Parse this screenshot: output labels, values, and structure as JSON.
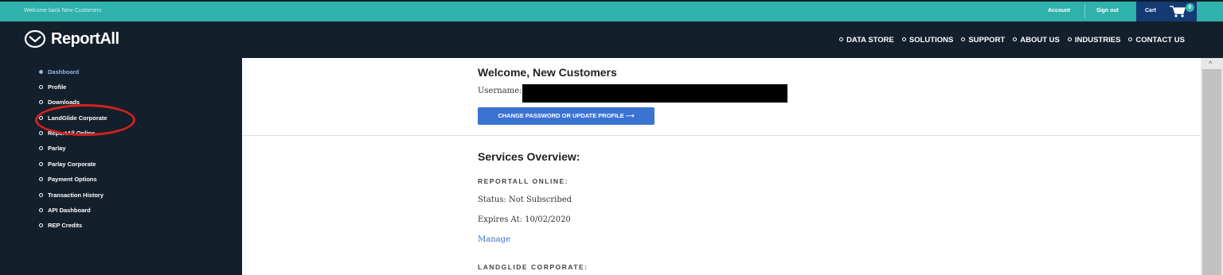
{
  "topbar": {
    "welcome_text": "Welcome back New Customers",
    "account_label": "Account",
    "signout_label": "Sign out",
    "cart_label": "Cart",
    "cart_count": "0"
  },
  "header": {
    "logo_text": "ReportAll",
    "nav": [
      "DATA STORE",
      "SOLUTIONS",
      "SUPPORT",
      "ABOUT US",
      "INDUSTRIES",
      "CONTACT US"
    ]
  },
  "sidebar": {
    "items": [
      {
        "label": "Dashboard",
        "active": true
      },
      {
        "label": "Profile"
      },
      {
        "label": "Downloads"
      },
      {
        "label": "LandGlide Corporate"
      },
      {
        "label": "ReportAll Online"
      },
      {
        "label": "Parlay"
      },
      {
        "label": "Parlay Corporate"
      },
      {
        "label": "Payment Options"
      },
      {
        "label": "Transaction History"
      },
      {
        "label": "API Dashboard"
      },
      {
        "label": "REP Credits"
      }
    ]
  },
  "main": {
    "welcome_heading": "Welcome, New Customers",
    "username_label": "Username:",
    "change_button": "CHANGE PASSWORD OR UPDATE PROFILE ⟶",
    "services_heading": "Services Overview:",
    "reportall_online_heading": "REPORTALL ONLINE:",
    "status_text": "Status: Not Subscribed",
    "expires_text": "Expires At: 10/02/2020",
    "manage_link": "Manage",
    "landglide_heading": "LANDGLIDE CORPORATE:"
  },
  "colors": {
    "topbar": "#2fb1ac",
    "header": "#13202c",
    "cart": "#133a73",
    "button": "#3b73d3",
    "link": "#3b6fc6",
    "annotation": "#d62020"
  }
}
